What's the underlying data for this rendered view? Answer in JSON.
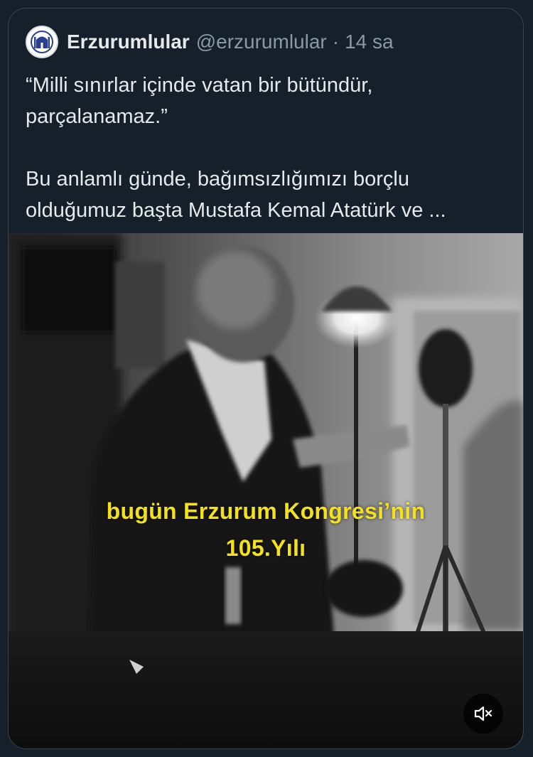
{
  "tweet": {
    "display_name": "Erzurumlular",
    "handle": "@erzurumlular",
    "separator": "·",
    "time": "14 sa",
    "text_line1": "“Milli sınırlar içinde vatan bir bütündür,",
    "text_line2": "parçalanamaz.”",
    "text_line3": "Bu anlamlı günde, bağımsızlığımızı borçlu",
    "text_line4": "olduğumuz başta Mustafa Kemal Atatürk ve ..."
  },
  "video": {
    "caption_line1": "bugün Erzurum Kongresi’nin",
    "caption_line2": "105.Yılı",
    "mute_icon": "speaker-muted-icon"
  },
  "colors": {
    "background": "#15202b",
    "text_primary": "#e7e9ea",
    "text_secondary": "#8b98a5",
    "border": "#38444d",
    "caption": "#f5e11b"
  }
}
